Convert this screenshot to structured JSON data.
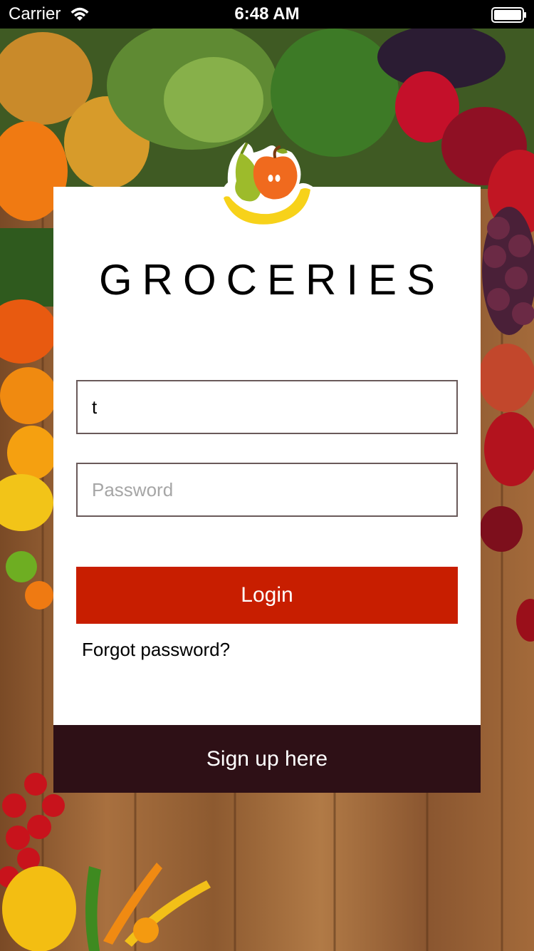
{
  "status_bar": {
    "carrier": "Carrier",
    "time": "6:48 AM",
    "wifi_icon": "wifi-icon",
    "battery_icon": "battery-icon"
  },
  "app": {
    "title": "GROCERIES",
    "logo_icon": "fruit-basket-logo",
    "accent_color": "#c81e00",
    "signup_color": "#2e1016"
  },
  "login_form": {
    "email_value": "t",
    "password_placeholder": "Password",
    "login_label": "Login",
    "forgot_label": "Forgot password?",
    "signup_label": "Sign up here"
  }
}
